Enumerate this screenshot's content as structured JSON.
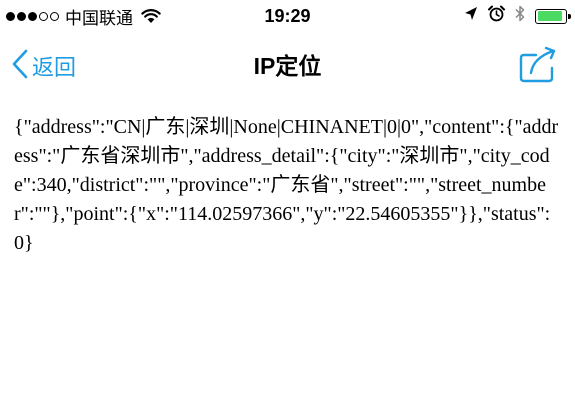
{
  "status_bar": {
    "signal": {
      "filled": 3,
      "total": 5
    },
    "carrier": "中国联通",
    "time": "19:29",
    "battery_level": 0.9,
    "battery_color": "#4cd964"
  },
  "nav": {
    "back_label": "返回",
    "title": "IP定位",
    "accent_color": "#1f9de0"
  },
  "content": {
    "text": "{\"address\":\"CN|广东|深圳|None|CHINANET|0|0\",\"content\":{\"address\":\"广东省深圳市\",\"address_detail\":{\"city\":\"深圳市\",\"city_code\":340,\"district\":\"\",\"province\":\"广东省\",\"street\":\"\",\"street_number\":\"\"},\"point\":{\"x\":\"114.02597366\",\"y\":\"22.54605355\"}},\"status\":0}"
  }
}
